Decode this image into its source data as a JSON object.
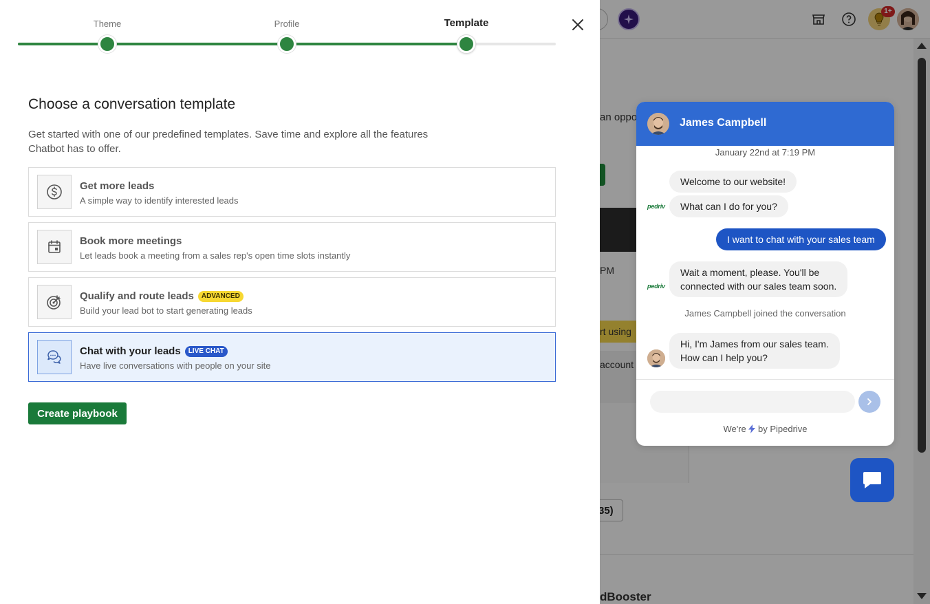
{
  "colors": {
    "accent_green": "#2e8540",
    "button_green": "#1a7a3a",
    "chat_blue": "#2f6ad2",
    "selected_bg": "#eaf2fd",
    "advanced_tag": "#f7d832",
    "live_tag": "#2a58c9"
  },
  "background": {
    "text_oppo": "an oppo",
    "text_pm": "PM",
    "text_start": "rt using",
    "text_account": "account",
    "outline_btn": "35)",
    "text_booster": "dBooster",
    "notification_badge": "1+"
  },
  "stepper": {
    "steps": [
      {
        "label": "Theme",
        "state": "complete"
      },
      {
        "label": "Profile",
        "state": "complete"
      },
      {
        "label": "Template",
        "state": "active"
      }
    ]
  },
  "main": {
    "heading": "Choose a conversation template",
    "description": "Get started with one of our predefined templates. Save time and explore all the features Chatbot has to offer.",
    "templates": [
      {
        "title": "Get more leads",
        "subtitle": "A simple way to identify interested leads",
        "icon": "dollar-icon",
        "tag": "",
        "selected": false
      },
      {
        "title": "Book more meetings",
        "subtitle": "Let leads book a meeting from a sales rep's open time slots instantly",
        "icon": "calendar-icon",
        "tag": "",
        "selected": false
      },
      {
        "title": "Qualify and route leads",
        "subtitle": "Build your lead bot to start generating leads",
        "icon": "target-icon",
        "tag": "ADVANCED",
        "selected": false
      },
      {
        "title": "Chat with your leads",
        "subtitle": "Have live conversations with people on your site",
        "icon": "chat-bubbles-icon",
        "tag": "LIVE CHAT",
        "selected": true
      }
    ],
    "create_button": "Create playbook"
  },
  "chat": {
    "agent_name": "James Campbell",
    "date": "January 22nd at 7:19 PM",
    "bot_logo_text": "pedriv",
    "messages": {
      "bot1": "Welcome to our website!",
      "bot2": "What can I do for you?",
      "user1": "I want to chat with your sales team",
      "bot3_line1": "Wait a moment, please. You'll be",
      "bot3_line2": "connected with our sales team soon.",
      "system": "James Campbell joined the conversation",
      "agent1_line1": "Hi, I'm James from our sales team.",
      "agent1_line2": "How can I help you?"
    },
    "input_placeholder": "",
    "powered_prefix": "We're",
    "powered_suffix": "by Pipedrive"
  }
}
